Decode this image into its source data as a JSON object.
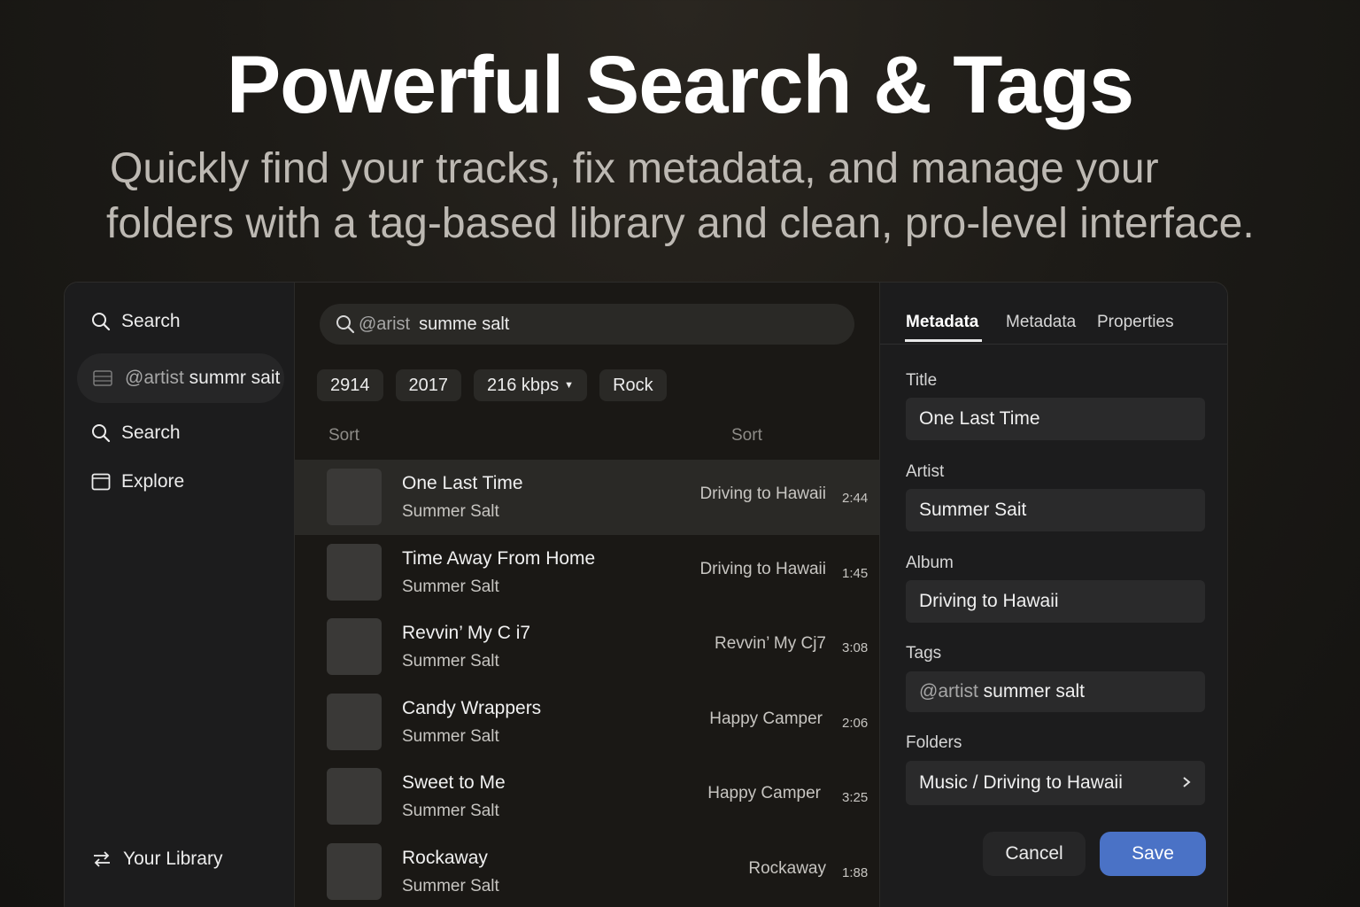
{
  "hero": {
    "title": "Powerful Search & Tags",
    "subtitle_line1": "Quickly find your tracks, fix metadata, and manage your",
    "subtitle_line2": "folders with a tag-based library and clean, pro-level interface."
  },
  "sidebar": {
    "search_top": "Search",
    "saved_search_prefix": "@artist",
    "saved_search_text": " summr sait",
    "search": "Search",
    "explore": "Explore",
    "library": "Your Library"
  },
  "list": {
    "search_prefix": "@arist",
    "search_text": "summe salt",
    "chips": [
      "2914",
      "2017",
      "216 kbps",
      "Rock"
    ],
    "sort_left": "Sort",
    "sort_right": "Sort",
    "tracks": [
      {
        "title": "One Last Time",
        "artist": "Summer Salt",
        "album": "Driving to Hawaii",
        "duration": "2:44"
      },
      {
        "title": "Time Away From Home",
        "artist": "Summer Salt",
        "album": "Driving to Hawaii",
        "duration": "1:45"
      },
      {
        "title": "Revvin’ My C i7",
        "artist": "Summer Salt",
        "album": "Revvin’ My Cj7",
        "duration": "3:08"
      },
      {
        "title": "Candy Wrappers",
        "artist": "Summer Salt",
        "album": "Happy Camper",
        "duration": "2:06"
      },
      {
        "title": "Sweet to Me",
        "artist": "Summer Salt",
        "album": "Happy Camper",
        "duration": "3:25"
      },
      {
        "title": "Rockaway",
        "artist": "Summer Salt",
        "album": "Rockaway",
        "duration": "1:88"
      }
    ]
  },
  "meta": {
    "tabs": [
      "Metadata",
      "Metadata",
      "Properties"
    ],
    "title_label": "Title",
    "title_value": "One Last Time",
    "artist_label": "Artist",
    "artist_value": "Summer Sait",
    "album_label": "Album",
    "album_value": "Driving to Hawaii",
    "tags_label": "Tags",
    "tags_prefix": "@artist",
    "tags_value": " summer salt",
    "folders_label": "Folders",
    "folders_value": "Music / Driving to Hawaii",
    "cancel": "Cancel",
    "save": "Save"
  },
  "colors": {
    "accent": "#4a72c6",
    "active_row": "#2a2926"
  },
  "icons": [
    "search-icon",
    "saved-search-icon",
    "explore-icon",
    "library-icon",
    "caret-down-icon",
    "chevron-right-icon"
  ]
}
